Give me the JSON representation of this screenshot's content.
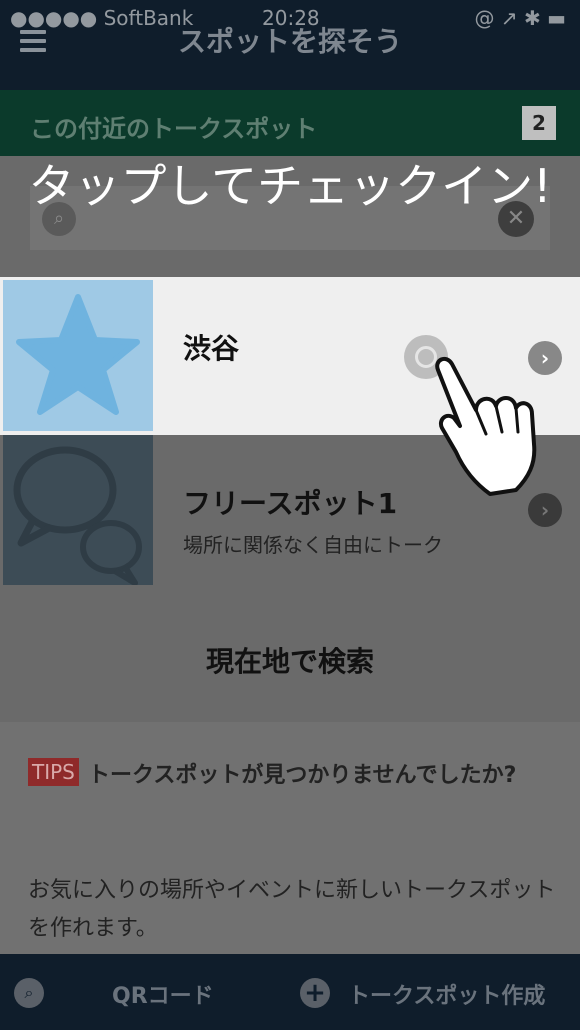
{
  "status": {
    "carrier": "●●●●● SoftBank",
    "time": "20:28",
    "right_icons": "@ ↗ ✱ ▬"
  },
  "nav": {
    "title": "スポットを探そう",
    "menu_icon": "menu-icon"
  },
  "nearby": {
    "label": "この付近のトークスポット",
    "count": "2"
  },
  "overlay": {
    "instruction": "タップしてチェックイン!"
  },
  "search": {
    "placeholder": "",
    "icon": "search-icon",
    "clear_icon": "clear-icon"
  },
  "spots": [
    {
      "name": "渋谷",
      "description": "",
      "icon": "star-icon"
    },
    {
      "name": "フリースポット1",
      "description": "場所に関係なく自由にトーク",
      "icon": "chat-bubbles-icon"
    }
  ],
  "location_search_label": "現在地で検索",
  "tips": {
    "badge": "TIPS",
    "headline": "トークスポットが見つかりませんでしたか?",
    "body": "お気に入りの場所やイベントに新しいトークスポットを作れます。"
  },
  "toolbar": {
    "qr_label": "QRコード",
    "create_label": "トークスポット作成"
  },
  "colors": {
    "nav_bg": "#0f1d2b",
    "nearby_bg": "#0b3a2b",
    "star_tile": "#9fc9e5",
    "tips_badge": "#8f2a2a"
  }
}
